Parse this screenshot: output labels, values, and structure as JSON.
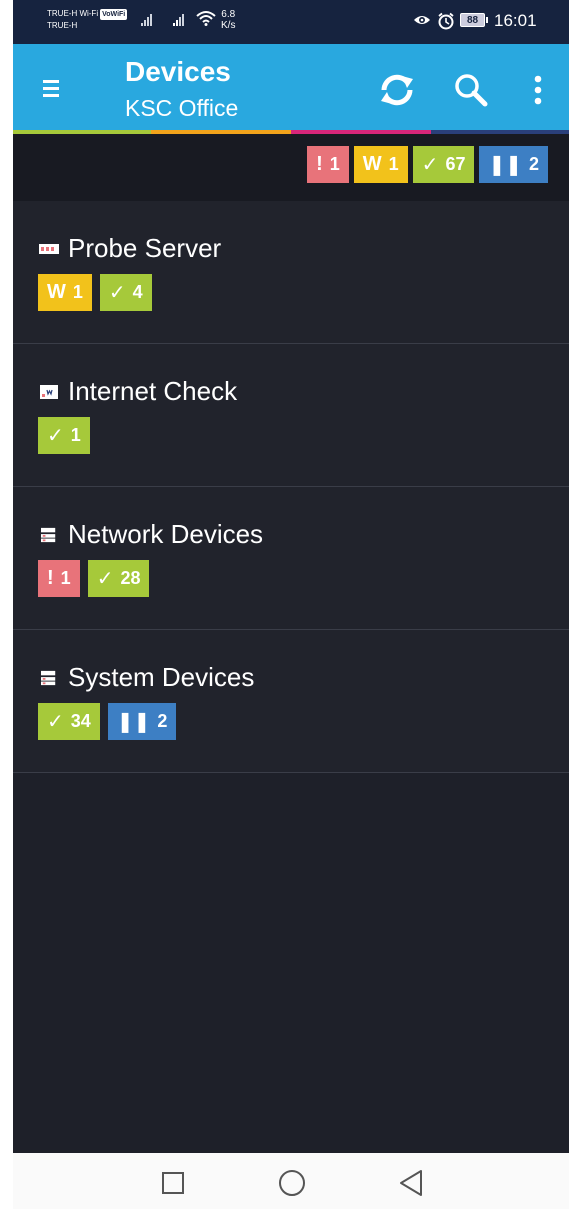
{
  "status_bar": {
    "carrier_line1": "TRUE-H Wi-Fi",
    "volte": "VoWiFi",
    "carrier_line2": "TRUE-H",
    "speed_value": "6.8",
    "speed_unit": "K/s",
    "battery": "88",
    "time": "16:01"
  },
  "header": {
    "title": "Devices",
    "subtitle": "KSC Office",
    "menu_icon": "menu-icon",
    "refresh_icon": "refresh-icon",
    "search_icon": "search-icon",
    "more_icon": "more-vertical-icon",
    "background": "#29a8df"
  },
  "summary": {
    "down": "1",
    "warning": "1",
    "up": "67",
    "paused": "2"
  },
  "colors": {
    "down": "#e8737a",
    "warning": "#f2c21b",
    "up": "#a6c93a",
    "paused": "#3d7fc4"
  },
  "groups": [
    {
      "name": "Probe Server",
      "icon": "probe-server-icon",
      "badges": [
        {
          "type": "warning",
          "symbol": "W",
          "count": "1"
        },
        {
          "type": "up",
          "symbol": "✓",
          "count": "4"
        }
      ]
    },
    {
      "name": "Internet Check",
      "icon": "internet-check-icon",
      "badges": [
        {
          "type": "up",
          "symbol": "✓",
          "count": "1"
        }
      ]
    },
    {
      "name": "Network Devices",
      "icon": "device-group-icon",
      "badges": [
        {
          "type": "down",
          "symbol": "!",
          "count": "1"
        },
        {
          "type": "up",
          "symbol": "✓",
          "count": "28"
        }
      ]
    },
    {
      "name": "System Devices",
      "icon": "device-group-icon",
      "badges": [
        {
          "type": "up",
          "symbol": "✓",
          "count": "34"
        },
        {
          "type": "paused",
          "symbol": "II",
          "count": "2"
        }
      ]
    }
  ],
  "nav": {
    "recents_icon": "square-icon",
    "home_icon": "circle-icon",
    "back_icon": "triangle-back-icon"
  }
}
